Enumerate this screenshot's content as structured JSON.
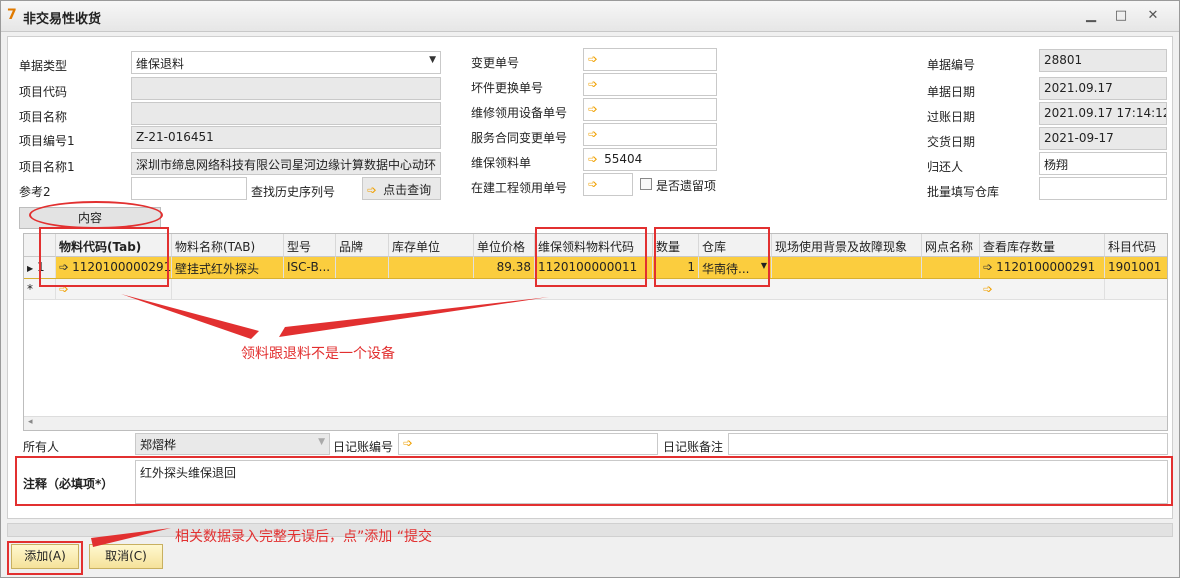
{
  "window": {
    "title": "非交易性收货"
  },
  "left_fields": [
    {
      "label": "单据类型",
      "value": "维保退料",
      "type": "select"
    },
    {
      "label": "项目代码",
      "value": "",
      "type": "ro"
    },
    {
      "label": "项目名称",
      "value": "",
      "type": "ro"
    },
    {
      "label": "项目编号1",
      "value": "Z-21-016451",
      "type": "ro"
    },
    {
      "label": "项目名称1",
      "value": "深圳市缔息网络科技有限公司星河边缘计算数据中心动环",
      "type": "ro"
    },
    {
      "label": "参考2",
      "value": "",
      "type": "input"
    }
  ],
  "history": {
    "label": "查找历史序列号",
    "button": "点击查询"
  },
  "middle_fields": [
    {
      "label": "变更单号",
      "value": ""
    },
    {
      "label": "坏件更换单号",
      "value": ""
    },
    {
      "label": "维修领用设备单号",
      "value": ""
    },
    {
      "label": "服务合同变更单号",
      "value": ""
    },
    {
      "label": "维保领料单",
      "value": "55404"
    },
    {
      "label": "在建工程领用单号",
      "value": ""
    }
  ],
  "checkbox": {
    "label": "是否遗留项"
  },
  "right_fields": [
    {
      "label": "单据编号",
      "value": "28801",
      "type": "ro"
    },
    {
      "label": "单据日期",
      "value": "2021.09.17",
      "type": "ro"
    },
    {
      "label": "过账日期",
      "value": "2021.09.17 17:14:12",
      "type": "ro"
    },
    {
      "label": "交货日期",
      "value": "2021-09-17",
      "type": "ro"
    },
    {
      "label": "归还人",
      "value": "杨翔",
      "type": "input"
    },
    {
      "label": "批量填写仓库",
      "value": "",
      "type": "input"
    }
  ],
  "tab": {
    "label": "内容"
  },
  "grid": {
    "columns": [
      "物料代码(Tab)",
      "物料名称(TAB)",
      "型号",
      "品牌",
      "库存单位",
      "单位价格",
      "维保领料物料代码",
      "数量",
      "仓库",
      "现场使用背景及故障现象",
      "网点名称",
      "查看库存数量",
      "科目代码"
    ],
    "row": {
      "index": "1",
      "item_code": "1120100000291",
      "item_name": "壁挂式红外探头",
      "model": "ISC-B...",
      "brand": "",
      "unit": "",
      "price": "89.38",
      "maint_code": "1120100000011",
      "qty": "1",
      "warehouse": "华南待...",
      "background": "",
      "site": "",
      "stock": "1120100000291",
      "account": "1901001"
    },
    "new_row_marker": "*"
  },
  "bottom": {
    "owner_label": "所有人",
    "owner_value": "郑熠桦",
    "journal_no_label": "日记账编号",
    "journal_note_label": "日记账备注",
    "remark_label": "注释（必填项*）",
    "remark_value": "红外探头维保退回"
  },
  "annotations": {
    "note1": "领料跟退料不是一个设备",
    "note2": "相关数据录入完整无误后，点”添加 “提交"
  },
  "buttons": {
    "add": "添加(A)",
    "cancel": "取消(C)"
  },
  "colors": {
    "selected_row": "#fbcd3e",
    "annotation_red": "#e23030",
    "arrow_icon": "#f0a000"
  }
}
